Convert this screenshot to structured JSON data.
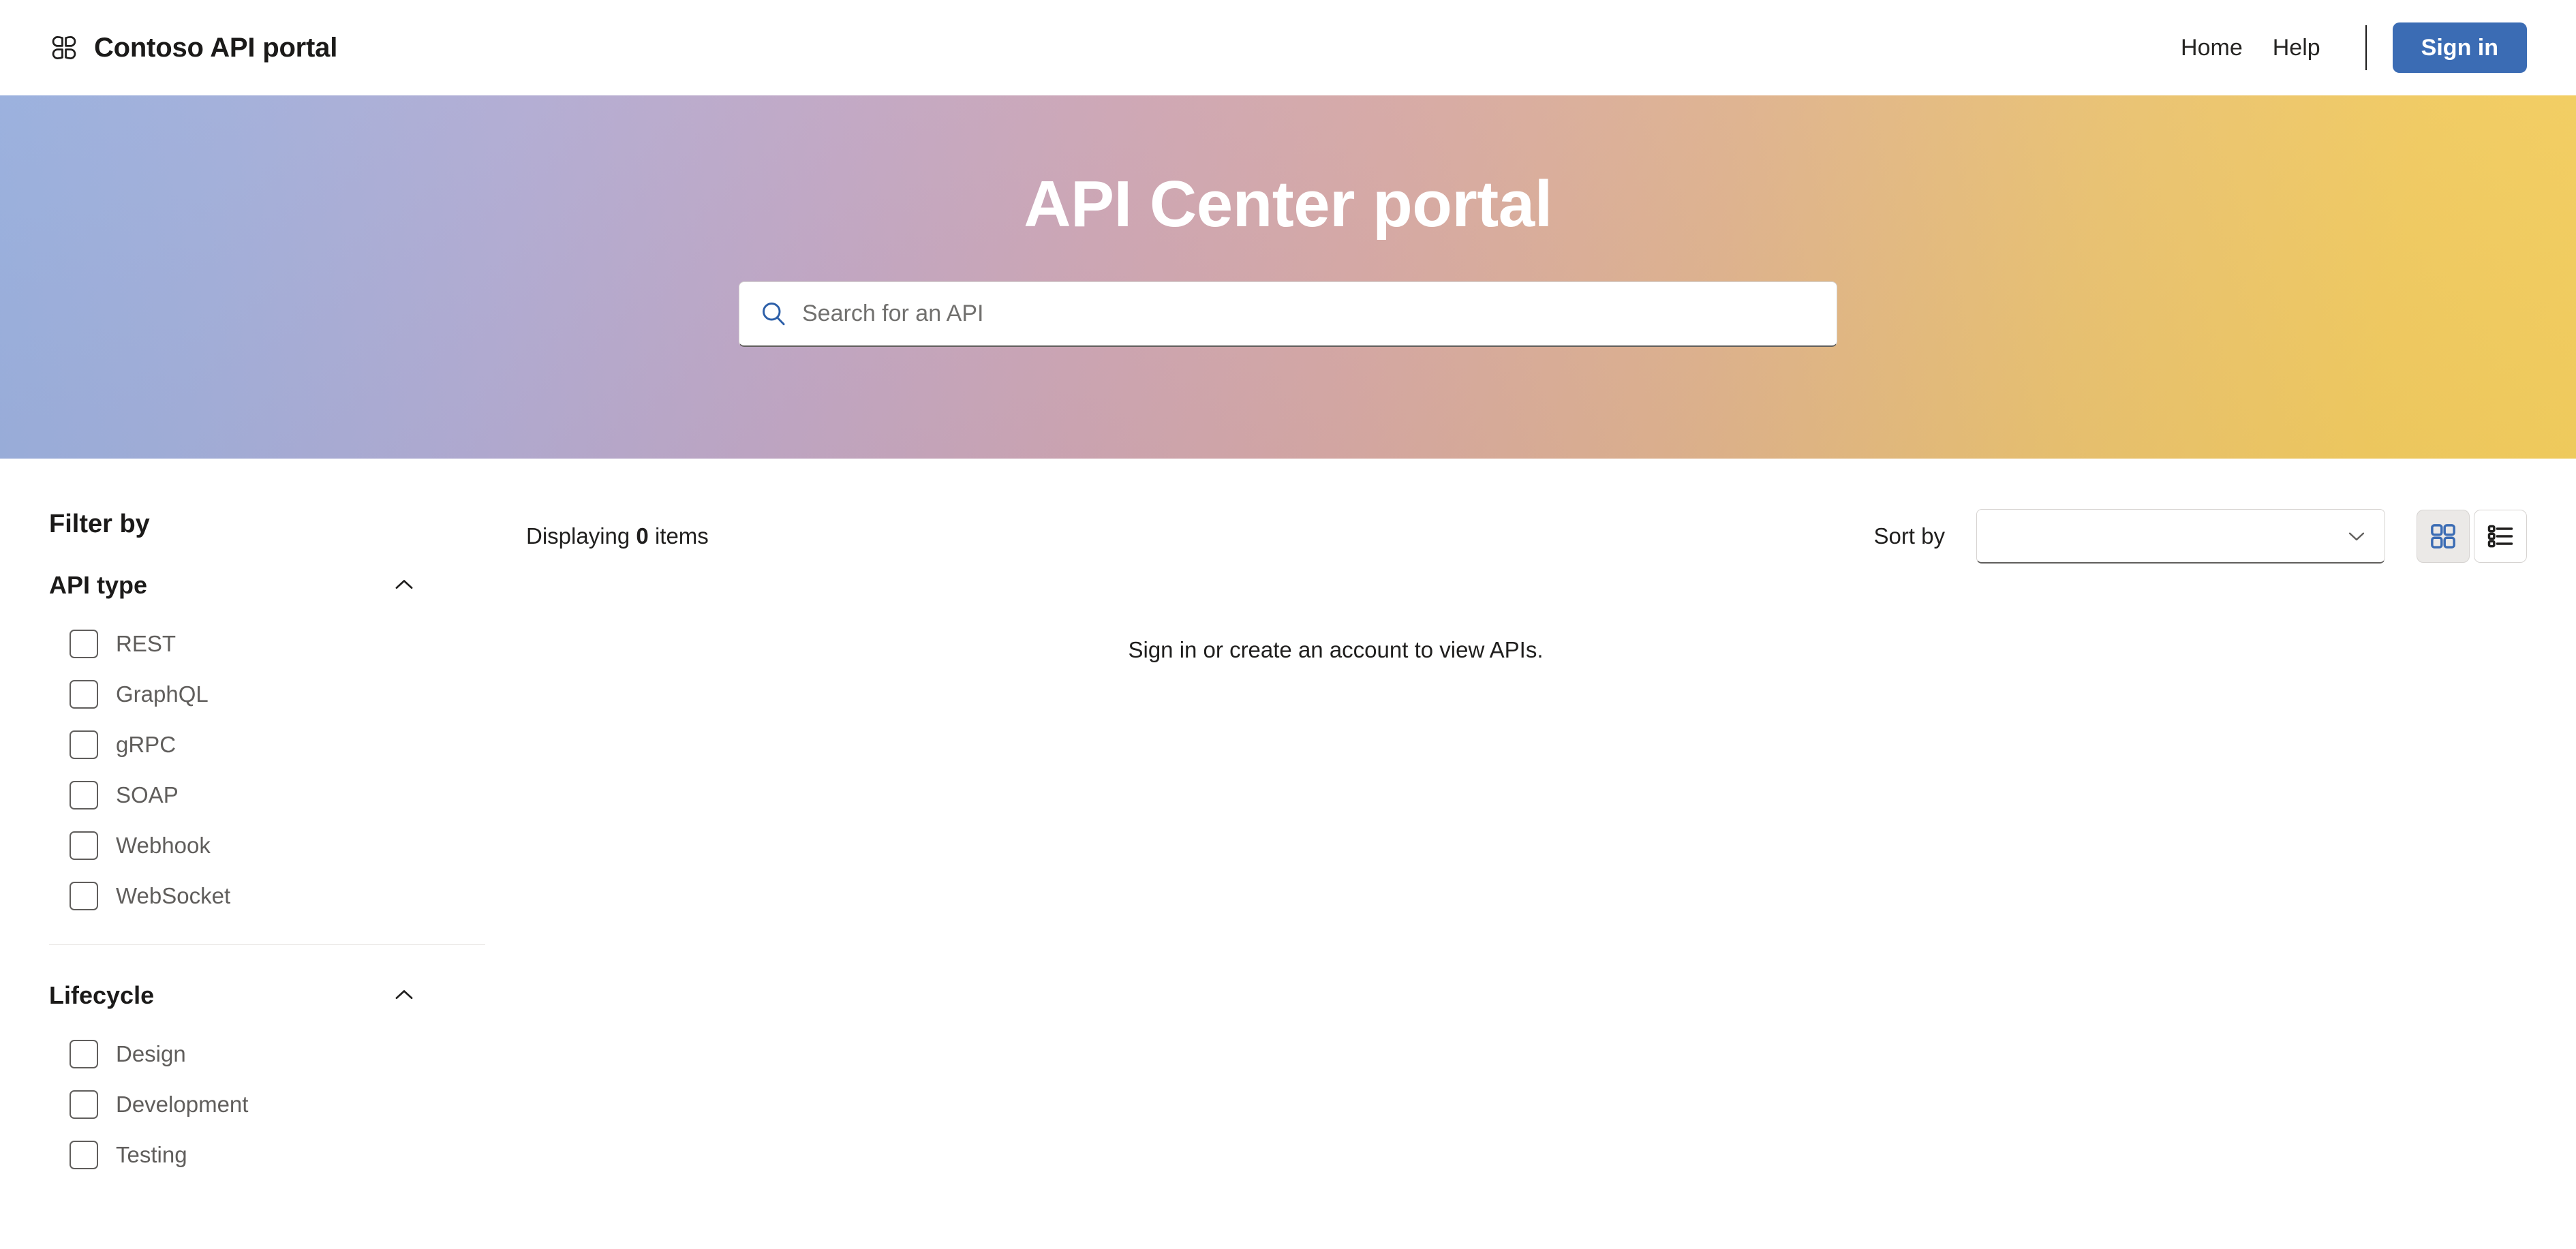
{
  "header": {
    "logo_icon": "clover-grid-logo-icon",
    "brand": "Contoso API portal",
    "nav": [
      {
        "label": "Home",
        "name": "home"
      },
      {
        "label": "Help",
        "name": "help"
      }
    ],
    "signin_label": "Sign in",
    "accent_color": "#3b6cb4"
  },
  "hero": {
    "title": "API Center portal",
    "search": {
      "placeholder": "Search for an API",
      "value": "",
      "icon": "search-icon"
    },
    "gradient": {
      "from": "#9cb3e2",
      "mid": "#cfa6b4",
      "to": "#f0c85a"
    }
  },
  "sidebar": {
    "heading": "Filter by",
    "facets": [
      {
        "title": "API type",
        "expanded": true,
        "collapse_icon": "chevron-up-icon",
        "options": [
          {
            "label": "REST",
            "checked": false
          },
          {
            "label": "GraphQL",
            "checked": false
          },
          {
            "label": "gRPC",
            "checked": false
          },
          {
            "label": "SOAP",
            "checked": false
          },
          {
            "label": "Webhook",
            "checked": false
          },
          {
            "label": "WebSocket",
            "checked": false
          }
        ]
      },
      {
        "title": "Lifecycle",
        "expanded": true,
        "collapse_icon": "chevron-up-icon",
        "options": [
          {
            "label": "Design",
            "checked": false
          },
          {
            "label": "Development",
            "checked": false
          },
          {
            "label": "Testing",
            "checked": false
          }
        ]
      }
    ]
  },
  "main": {
    "displaying_prefix": "Displaying",
    "displaying_count": "0",
    "displaying_suffix": "items",
    "sort_label": "Sort by",
    "sort_value": "",
    "view_grid_icon": "grid-view-icon",
    "view_list_icon": "list-view-icon",
    "view_selected": "grid",
    "empty_message": "Sign in or create an account to view APIs."
  }
}
